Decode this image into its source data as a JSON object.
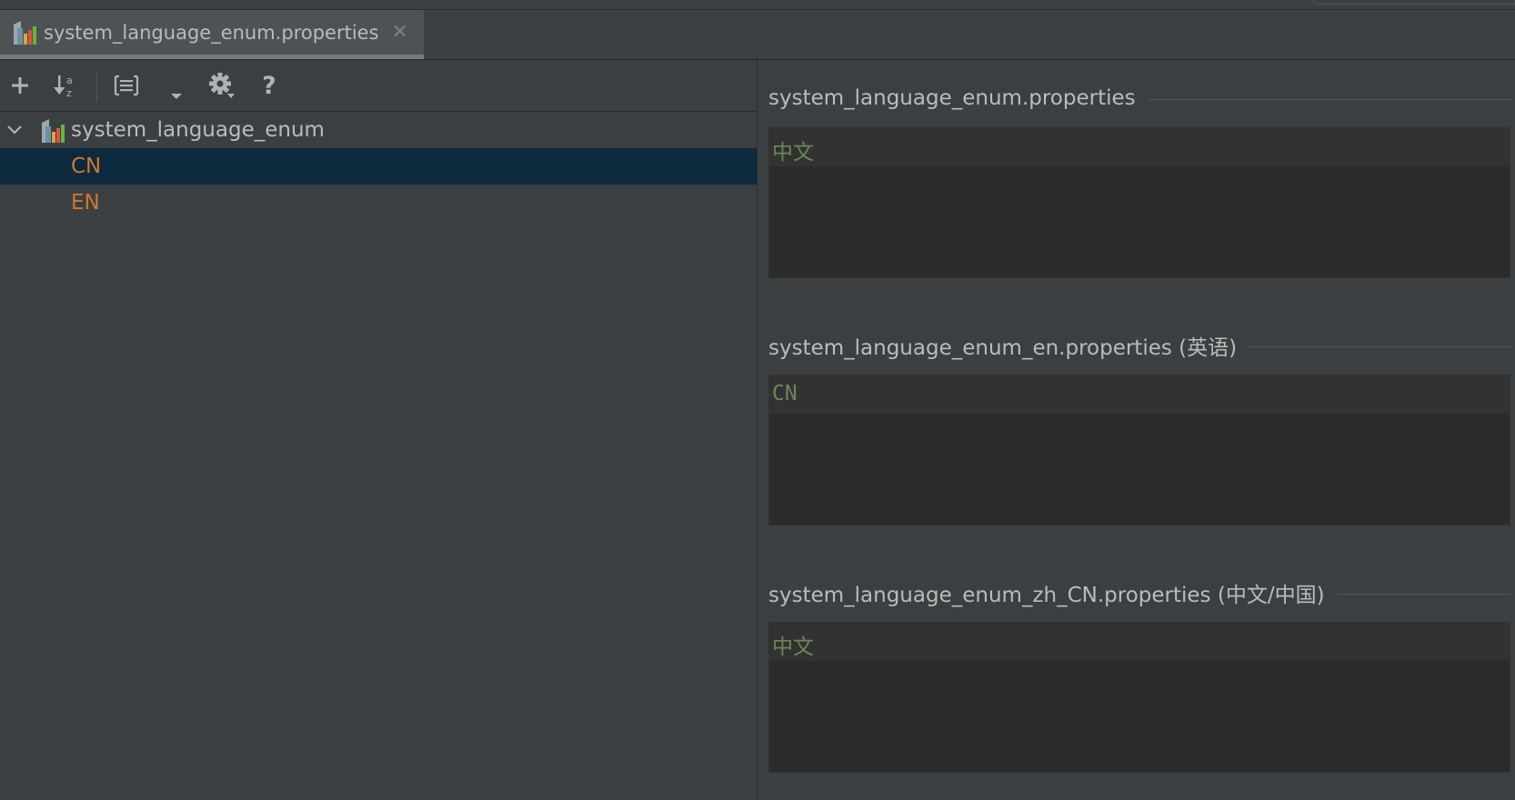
{
  "tab": {
    "title": "system_language_enum.properties",
    "close_symbol": "✕",
    "icon": "properties-file-icon"
  },
  "toolbar": {
    "add_symbol": "+",
    "help_symbol": "?",
    "icons": [
      "add-icon",
      "sort-alphabetically-icon",
      "group-icon",
      "dropdown-arrow-icon",
      "gear-icon",
      "help-icon"
    ]
  },
  "tree": {
    "root_label": "system_language_enum",
    "keys": [
      {
        "label": "CN",
        "selected": true
      },
      {
        "label": "EN",
        "selected": false
      }
    ]
  },
  "sections": [
    {
      "title": "system_language_enum.properties",
      "value": "中文"
    },
    {
      "title": "system_language_enum_en.properties (英语)",
      "value": "CN"
    },
    {
      "title": "system_language_enum_zh_CN.properties (中文/中国)",
      "value": "中文"
    }
  ],
  "colors": {
    "background": "#3c3f41",
    "editor_background": "#2b2b2b",
    "selection": "#0d293e",
    "key_text": "#cc7832",
    "value_text": "#6a8759"
  }
}
